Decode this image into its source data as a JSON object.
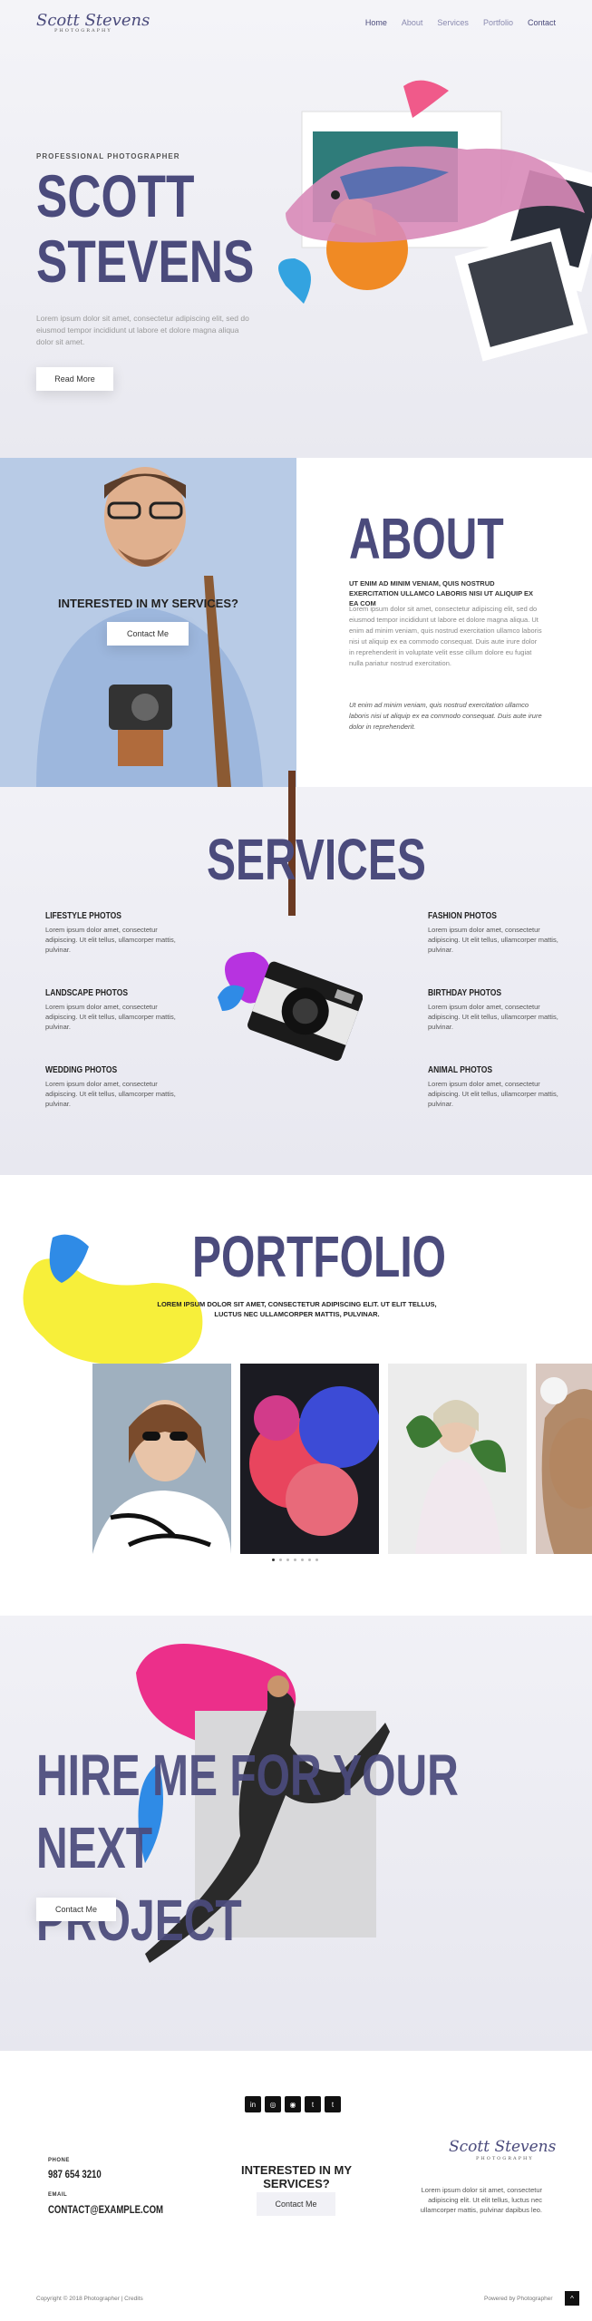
{
  "header": {
    "logo": "Scott Stevens",
    "logo_sub": "PHOTOGRAPHY",
    "nav": [
      "Home",
      "About",
      "Services",
      "Portfolio",
      "Contact"
    ]
  },
  "hero": {
    "kicker": "PROFESSIONAL PHOTOGRAPHER",
    "title_line1": "SCOTT",
    "title_line2": "STEVENS",
    "text": "Lorem ipsum dolor sit amet, consectetur adipiscing elit, sed do eiusmod tempor incididunt ut labore et dolore magna aliqua dolor sit amet.",
    "button": "Read More"
  },
  "about": {
    "cta_title": "INTERESTED IN MY SERVICES?",
    "cta_button": "Contact Me",
    "title": "ABOUT",
    "lead": "UT ENIM AD MINIM VENIAM, QUIS NOSTRUD EXERCITATION ULLAMCO LABORIS NISI UT ALIQUIP EX EA COM",
    "body": "Lorem ipsum dolor sit amet, consectetur adipiscing elit, sed do eiusmod tempor incididunt ut labore et dolore magna aliqua. Ut enim ad minim veniam, quis nostrud exercitation ullamco laboris nisi ut aliquip ex ea commodo consequat. Duis aute irure dolor in reprehenderit in voluptate velit esse cillum dolore eu fugiat nulla pariatur nostrud exercitation.",
    "body2": "Ut enim ad minim veniam, quis nostrud exercitation ullamco laboris nisi ut aliquip ex ea commodo consequat. Duis aute irure dolor in reprehenderit."
  },
  "services": {
    "title": "SERVICES",
    "items": [
      {
        "title": "LIFESTYLE PHOTOS",
        "text": "Lorem ipsum dolor amet, consectetur adipiscing. Ut elit tellus, ullamcorper mattis, pulvinar."
      },
      {
        "title": "FASHION PHOTOS",
        "text": "Lorem ipsum dolor amet, consectetur adipiscing. Ut elit tellus, ullamcorper mattis, pulvinar."
      },
      {
        "title": "LANDSCAPE PHOTOS",
        "text": "Lorem ipsum dolor amet, consectetur adipiscing. Ut elit tellus, ullamcorper mattis, pulvinar."
      },
      {
        "title": "BIRTHDAY PHOTOS",
        "text": "Lorem ipsum dolor amet, consectetur adipiscing. Ut elit tellus, ullamcorper mattis, pulvinar."
      },
      {
        "title": "WEDDING PHOTOS",
        "text": "Lorem ipsum dolor amet, consectetur adipiscing. Ut elit tellus, ullamcorper mattis, pulvinar."
      },
      {
        "title": "ANIMAL PHOTOS",
        "text": "Lorem ipsum dolor amet, consectetur adipiscing. Ut elit tellus, ullamcorper mattis, pulvinar."
      }
    ]
  },
  "portfolio": {
    "title": "PORTFOLIO",
    "text": "LOREM IPSUM DOLOR SIT AMET, CONSECTETUR ADIPISCING ELIT. UT ELIT TELLUS, LUCTUS NEC ULLAMCORPER MATTIS, PULVINAR."
  },
  "hire": {
    "title_line1": "HIRE ME FOR YOUR NEXT",
    "title_line2": "PROJECT",
    "button": "Contact Me"
  },
  "footer": {
    "social": [
      "in",
      "◎",
      "◉",
      "t",
      "t"
    ],
    "phone_label": "PHONE",
    "phone": "987 654 3210",
    "email_label": "EMAIL",
    "email": "CONTACT@EXAMPLE.COM",
    "cta_title": "INTERESTED IN MY SERVICES?",
    "cta_button": "Contact Me",
    "logo": "Scott Stevens",
    "logo_sub": "PHOTOGRAPHY",
    "about": "Lorem ipsum dolor sit amet, consectetur adipiscing elit. Ut elit tellus, luctus nec ullamcorper mattis, pulvinar dapibus leo.",
    "copyright": "Copyright © 2018 Photographer | Credits",
    "powered": "Powered by Photographer",
    "to_top": "^"
  },
  "colors": {
    "brand": "#4b4b7c",
    "accent_pink": "#ef3d8e",
    "accent_yellow": "#f7ef3a"
  }
}
